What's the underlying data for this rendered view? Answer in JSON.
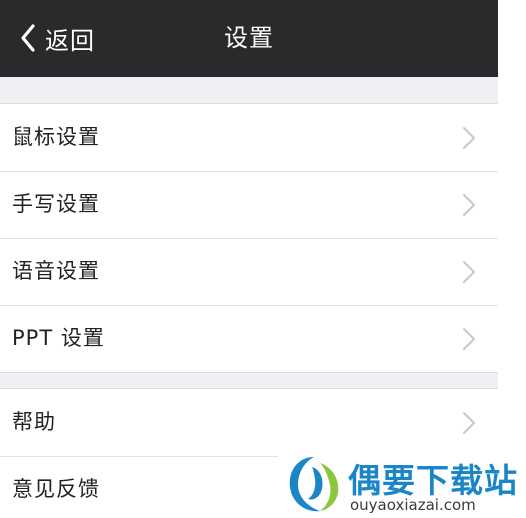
{
  "nav": {
    "back_label": "返回",
    "title": "设置"
  },
  "settings": {
    "group1": [
      {
        "label": "鼠标设置",
        "icon": "chevron-right-icon"
      },
      {
        "label": "手写设置",
        "icon": "chevron-right-icon"
      },
      {
        "label": "语音设置",
        "icon": "chevron-right-icon"
      },
      {
        "label": "PPT 设置",
        "icon": "chevron-right-icon"
      }
    ],
    "group2": [
      {
        "label": "帮助",
        "icon": "chevron-right-icon"
      },
      {
        "label": "意见反馈",
        "icon": "chevron-right-icon"
      }
    ]
  },
  "watermark": {
    "title": "偶要下载站",
    "url": "ouyaoxiazai.com"
  },
  "colors": {
    "nav_background": "#2a2a2c",
    "page_background": "#efeff4",
    "row_background": "#ffffff",
    "chevron": "#c7c7cc",
    "watermark_blue": "#1a86c8",
    "watermark_green": "#8cc63f"
  }
}
